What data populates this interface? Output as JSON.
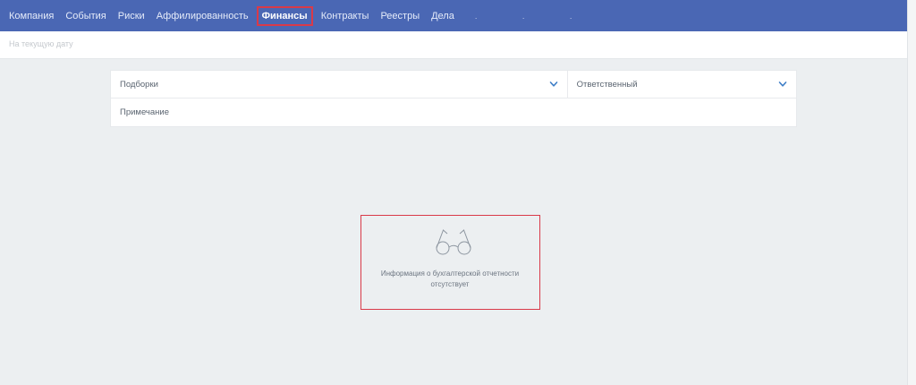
{
  "nav": {
    "tabs": [
      {
        "label": "Компания"
      },
      {
        "label": "События"
      },
      {
        "label": "Риски"
      },
      {
        "label": "Аффилированность"
      },
      {
        "label": "Финансы",
        "active": true
      },
      {
        "label": "Контракты"
      },
      {
        "label": "Реестры"
      },
      {
        "label": "Дела"
      }
    ],
    "trailing": ". . ."
  },
  "subbar": {
    "date_label": "На текущую дату"
  },
  "filters": {
    "collections_label": "Подборки",
    "responsible_label": "Ответственный",
    "note_label": "Примечание"
  },
  "empty_state": {
    "icon": "glasses-icon",
    "message_line1": "Информация о бухгалтерской отчетности",
    "message_line2": "отсутствует"
  },
  "colors": {
    "nav_bg": "#4a67b4",
    "page_bg": "#eceff1",
    "highlight": "#d93a49",
    "chevron": "#3f7fc7"
  }
}
